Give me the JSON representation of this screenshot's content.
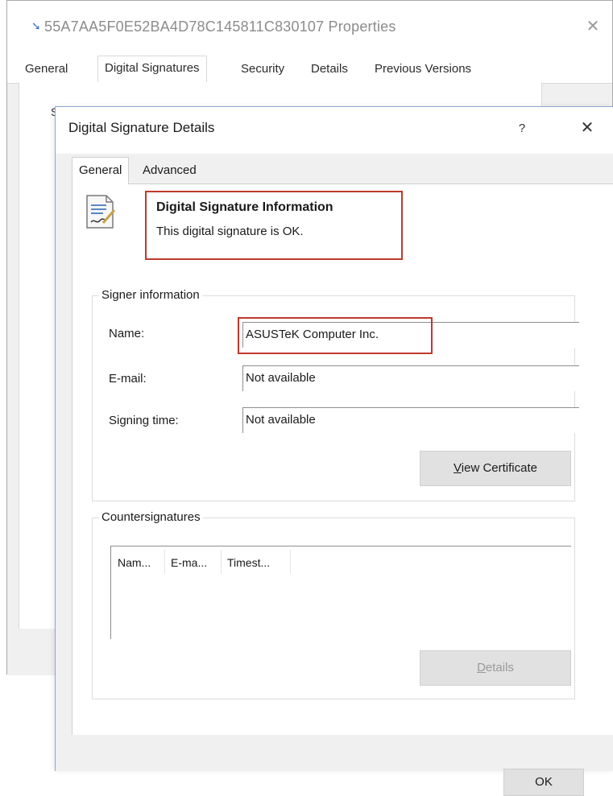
{
  "background_window": {
    "title": "55A7AA5F0E52BA4D78C145811C830107 Properties",
    "close_glyph": "✕",
    "tabs": [
      {
        "label": "General"
      },
      {
        "label": "Digital Signatures"
      },
      {
        "label": "Security"
      },
      {
        "label": "Details"
      },
      {
        "label": "Previous Versions"
      }
    ],
    "selected_tab": "Digital Signatures",
    "cut_text": "S"
  },
  "dialog": {
    "title": "Digital Signature Details",
    "help_glyph": "?",
    "close_glyph": "✕",
    "tabs": [
      {
        "label": "General"
      },
      {
        "label": "Advanced"
      }
    ],
    "selected_tab": "General",
    "info": {
      "heading": "Digital Signature Information",
      "status": "This digital signature is OK."
    },
    "signer": {
      "group_label": "Signer information",
      "name_label": "Name:",
      "name_value": "ASUSTeK Computer Inc.",
      "email_label": "E-mail:",
      "email_value": "Not available",
      "time_label": "Signing time:",
      "time_value": "Not available",
      "view_cert_first": "V",
      "view_cert_rest": "iew Certificate"
    },
    "countersignatures": {
      "group_label": "Countersignatures",
      "columns": [
        "Nam...",
        "E-ma...",
        "Timest..."
      ],
      "details_first": "D",
      "details_rest": "etails"
    },
    "ok_label": "OK"
  },
  "icons": {
    "title_icon": "signature-file-icon",
    "doc_icon": "digital-signature-document-icon"
  },
  "colors": {
    "highlight": "#c0392b",
    "button_face": "#e1e1e1",
    "dialog_border": "#8aa7d4"
  }
}
